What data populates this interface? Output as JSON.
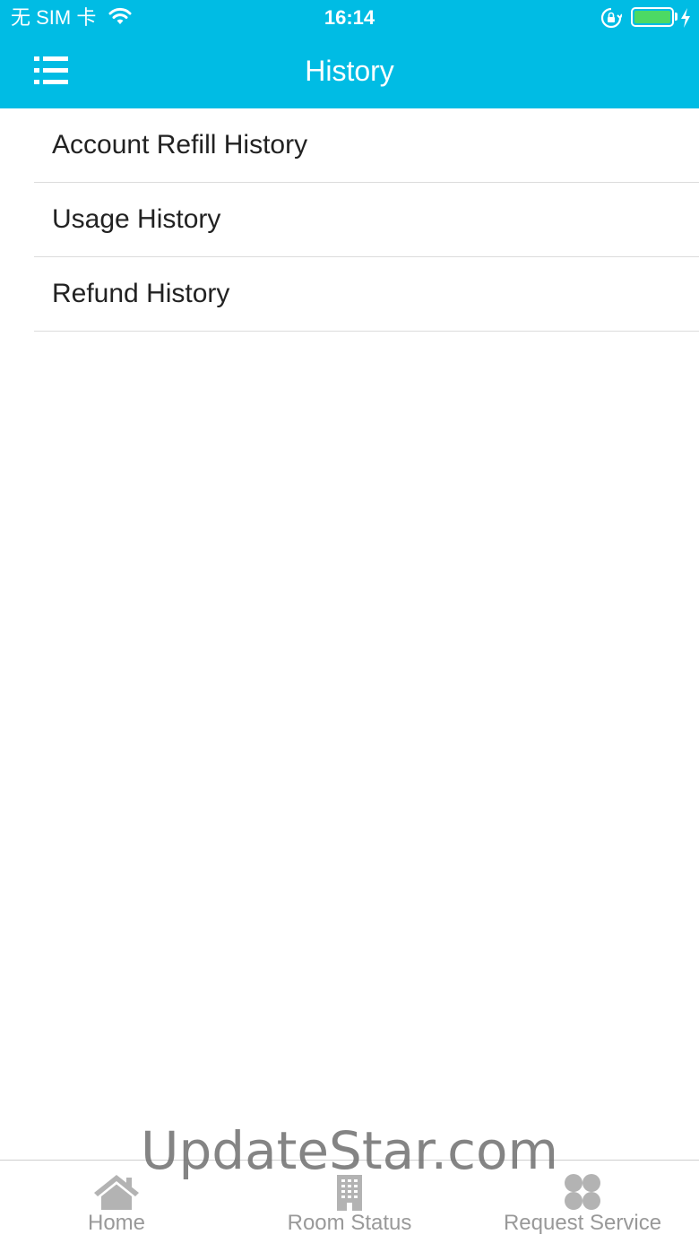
{
  "status_bar": {
    "carrier": "无 SIM 卡",
    "time": "16:14",
    "battery_color": "#4cd964"
  },
  "nav": {
    "title": "History",
    "menu_icon": "list-menu-icon",
    "background_color": "#00bce4"
  },
  "history_items": [
    {
      "label": "Account Refill History"
    },
    {
      "label": "Usage History"
    },
    {
      "label": "Refund History"
    }
  ],
  "tabs": [
    {
      "label": "Home",
      "icon": "home-icon"
    },
    {
      "label": "Room Status",
      "icon": "building-icon"
    },
    {
      "label": "Request Service",
      "icon": "clover-icon"
    }
  ],
  "watermark": "UpdateStar.com"
}
